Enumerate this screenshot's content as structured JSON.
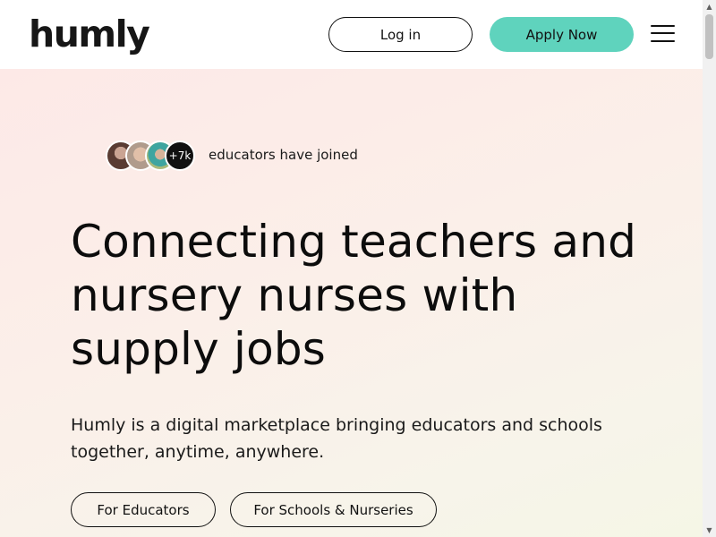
{
  "header": {
    "logo": "humly",
    "login_label": "Log in",
    "apply_label": "Apply Now",
    "menu_icon": "hamburger-menu-icon"
  },
  "hero": {
    "avatar_count_label": "+7k",
    "joined_text": "educators have joined",
    "headline": "Connecting teachers and nursery nurses with supply jobs",
    "subtext": "Humly is a digital marketplace bringing educators and schools together, anytime, anywhere.",
    "cta_educators": "For Educators",
    "cta_schools": "For Schools & Nurseries"
  },
  "colors": {
    "accent": "#5fd3bd",
    "hero_bg_start": "#fde9e7",
    "hero_bg_end": "#f5f6e6",
    "text": "#111111"
  },
  "scrollbar": {
    "up_icon": "scroll-up-arrow-icon",
    "down_icon": "scroll-down-arrow-icon"
  }
}
